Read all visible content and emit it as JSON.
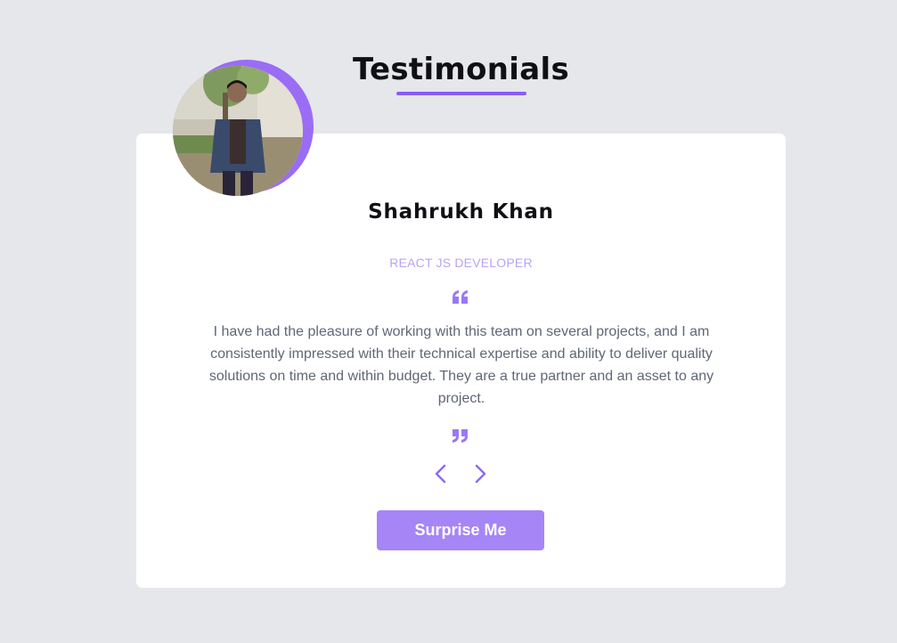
{
  "header": {
    "title": "Testimonials"
  },
  "testimonial": {
    "name": "Shahrukh Khan",
    "job": "React JS Developer",
    "text": "I have had the pleasure of working with this team on several projects, and I am consistently impressed with their technical expertise and ability to deliver quality solutions on time and within budget. They are a true partner and an asset to any project."
  },
  "icons": {
    "avatar": "person-photo",
    "quote_open": "quote-left-icon",
    "quote_close": "quote-right-icon",
    "prev": "chevron-left-icon",
    "next": "chevron-right-icon"
  },
  "controls": {
    "surprise_label": "Surprise Me"
  },
  "colors": {
    "background": "#e5e7eb",
    "card": "#ffffff",
    "accent": "#8b5cf6",
    "button": "#a685f7",
    "job": "#b9a3f3",
    "text": "#5f6776"
  }
}
